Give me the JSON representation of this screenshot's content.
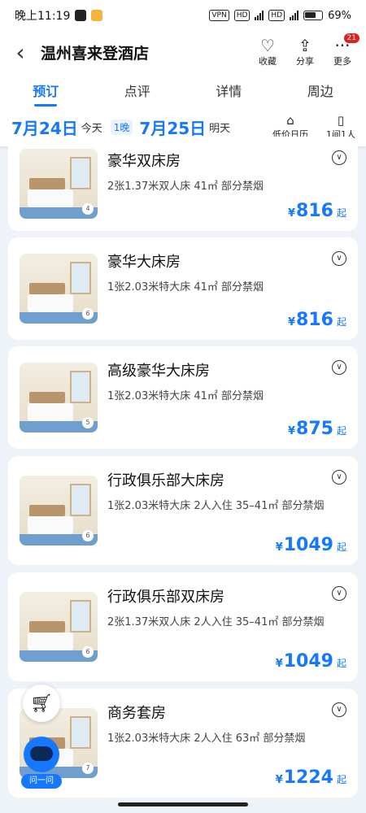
{
  "status": {
    "time": "晚上11:19",
    "vpn": "VPN",
    "hd1": "HD",
    "hd2": "HD",
    "battery": "69%"
  },
  "header": {
    "back": "‹",
    "title": "温州喜来登酒店",
    "actions": [
      {
        "label": "收藏",
        "icon": "♡"
      },
      {
        "label": "分享",
        "icon": "⇪"
      },
      {
        "label": "更多",
        "icon": "···",
        "badge": "21"
      }
    ]
  },
  "tabs": [
    "预订",
    "点评",
    "详情",
    "周边"
  ],
  "dates": {
    "checkin": "7月24日",
    "checkin_day": "今天",
    "nights": "1晚",
    "checkout": "7月25日",
    "checkout_day": "明天",
    "calendar_label": "低价日历",
    "guests_label": "1间1人"
  },
  "rooms": [
    {
      "name": "豪华双床房",
      "desc": "2张1.37米双人床  41㎡  部分禁烟",
      "price": "816",
      "photos": "4"
    },
    {
      "name": "豪华大床房",
      "desc": "1张2.03米特大床  41㎡  部分禁烟",
      "price": "816",
      "photos": "6"
    },
    {
      "name": "高级豪华大床房",
      "desc": "1张2.03米特大床  41㎡  部分禁烟",
      "price": "875",
      "photos": "5"
    },
    {
      "name": "行政俱乐部大床房",
      "desc": "1张2.03米特大床  2人入住  35–41㎡  部分禁烟",
      "price": "1049",
      "photos": "6"
    },
    {
      "name": "行政俱乐部双床房",
      "desc": "2张1.37米双人床  2人入住  35–41㎡  部分禁烟",
      "price": "1049",
      "photos": "6"
    },
    {
      "name": "商务套房",
      "desc": "1张2.03米特大床  2人入住  63㎡  部分禁烟",
      "price": "1224",
      "photos": "7"
    }
  ],
  "price_prefix": "¥",
  "price_suffix": "起",
  "assistant_label": "问一问",
  "accent": "#1677ff"
}
